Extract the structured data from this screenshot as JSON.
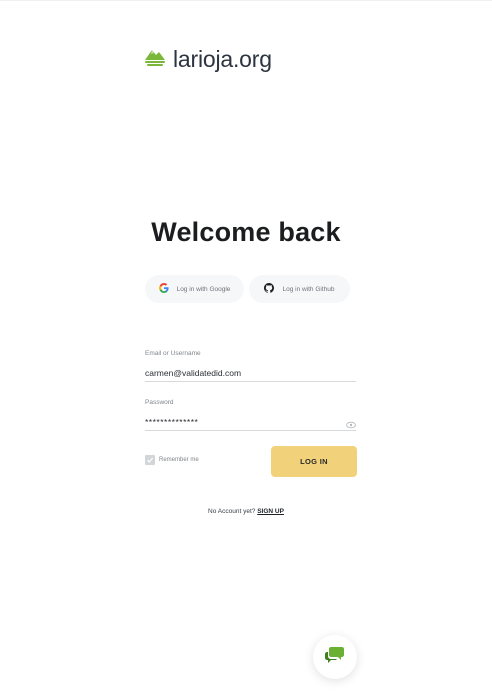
{
  "brand": {
    "name": "larioja.org",
    "logo_icon": "mountain-landscape-icon",
    "logo_color": "#7bb73a"
  },
  "main": {
    "title": "Welcome back"
  },
  "social_login": {
    "google_label": "Log in with Google",
    "github_label": "Log in with Github"
  },
  "form": {
    "email_label": "Email or Username",
    "email_value": "carmen@validatedid.com",
    "password_label": "Password",
    "password_value": "**************",
    "remember_label": "Remember me",
    "remember_checked": true,
    "login_label": "LOG IN"
  },
  "footer": {
    "no_account_text": "No Account yet?",
    "signup_label": "SIGN UP"
  },
  "chat": {
    "icon": "chat-bubbles-icon",
    "color": "#6ab032"
  },
  "colors": {
    "accent_button": "#f1d27b",
    "social_bg": "#f6f7f8"
  }
}
